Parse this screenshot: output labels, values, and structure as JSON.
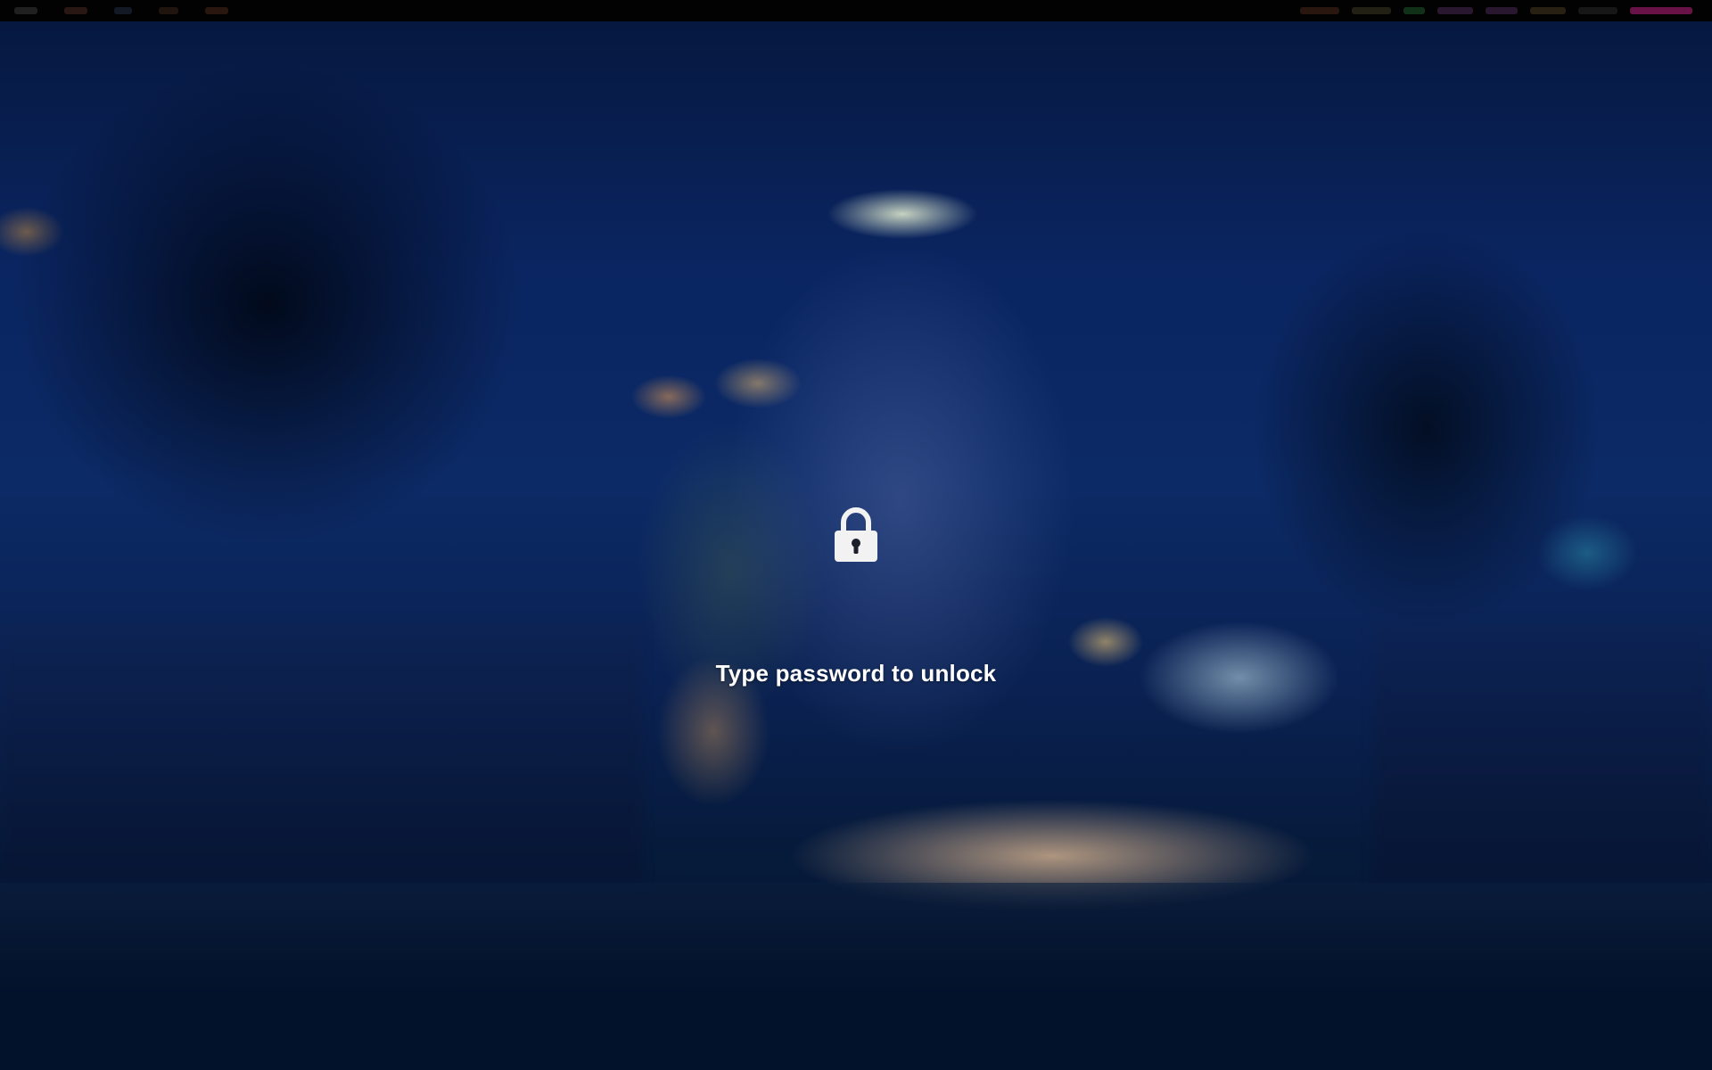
{
  "lock_screen": {
    "message": "Type password to unlock",
    "icon": "padlock-icon"
  },
  "colors": {
    "topbar_background": "#020203",
    "message_text": "#ffffff",
    "lock_icon": "#f2f2f2",
    "sky_dark": "#06173d"
  },
  "topbar": {
    "left_items": [
      {
        "icon": "workspace-indicator-1",
        "color": "#3a3a3a"
      },
      {
        "icon": "workspace-indicator-2",
        "color": "#4a2a22"
      },
      {
        "icon": "workspace-indicator-3",
        "color": "#223044"
      },
      {
        "icon": "workspace-indicator-4",
        "color": "#3a2418"
      },
      {
        "icon": "workspace-indicator-5",
        "color": "#4a2a1a"
      }
    ],
    "right_items": [
      {
        "icon": "status-indicator-1",
        "color": "#4a2a1a"
      },
      {
        "icon": "status-indicator-2",
        "color": "#3e3a22"
      },
      {
        "icon": "status-indicator-3",
        "color": "#1e5a2a"
      },
      {
        "icon": "status-indicator-4",
        "color": "#4a2a55"
      },
      {
        "icon": "status-indicator-5",
        "color": "#4a2a55"
      },
      {
        "icon": "status-indicator-6",
        "color": "#4a3a22"
      },
      {
        "icon": "status-indicator-7",
        "color": "#2a2a2a"
      },
      {
        "icon": "status-indicator-8",
        "color": "#c02080"
      }
    ]
  }
}
